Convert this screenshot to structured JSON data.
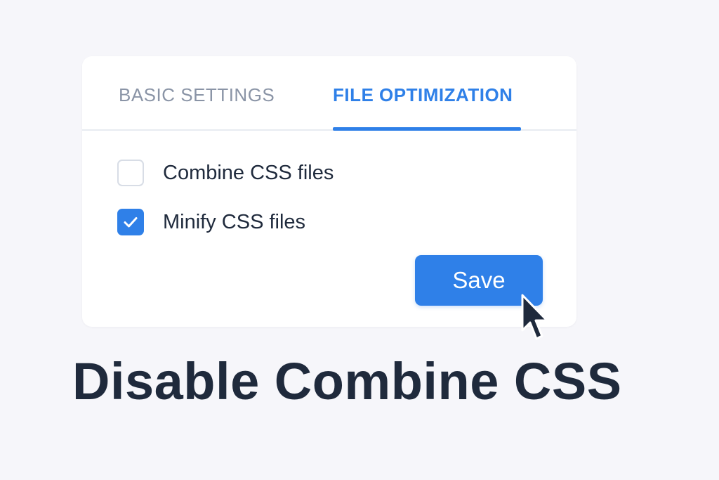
{
  "tabs": [
    {
      "label": "BASIC SETTINGS",
      "active": false
    },
    {
      "label": "FILE OPTIMIZATION",
      "active": true
    }
  ],
  "options": [
    {
      "label": "Combine CSS files",
      "checked": false
    },
    {
      "label": "Minify CSS files",
      "checked": true
    }
  ],
  "save_button": {
    "label": "Save"
  },
  "headline": "Disable Combine CSS",
  "icons": {
    "checkmark": "check-icon",
    "cursor": "mouse-pointer-icon"
  },
  "colors": {
    "accent": "#2f80e8",
    "text_dark": "#1f2a3c",
    "tab_inactive": "#8a94a6",
    "background": "#f6f6fa",
    "card": "#ffffff"
  }
}
